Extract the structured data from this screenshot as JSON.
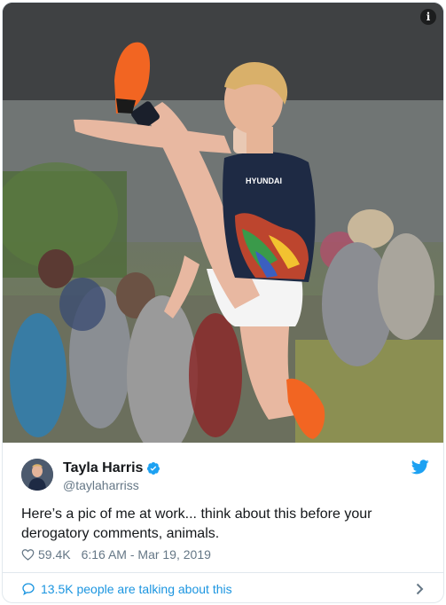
{
  "tweet": {
    "author_name": "Tayla Harris",
    "author_handle": "@taylaharriss",
    "text": "Here’s a pic of me at work... think about this before your derogatory comments, animals.",
    "likes": "59.4K",
    "timestamp": "6:16 AM - Mar 19, 2019",
    "conversation": "13.5K people are talking about this"
  },
  "media": {
    "info_glyph": "i",
    "jersey_brand": "HYUNDAI"
  },
  "icons": {
    "verified": "verified-badge-icon",
    "twitter": "twitter-bird-icon",
    "like": "heart-icon",
    "reply": "speech-bubble-icon",
    "more": "chevron-right-icon"
  },
  "colors": {
    "twitter_blue": "#1da1f2",
    "link_blue": "#1b95e0",
    "text": "#14171a",
    "secondary_text": "#657786",
    "border": "#e1e8ed",
    "boot_orange": "#f26522"
  }
}
